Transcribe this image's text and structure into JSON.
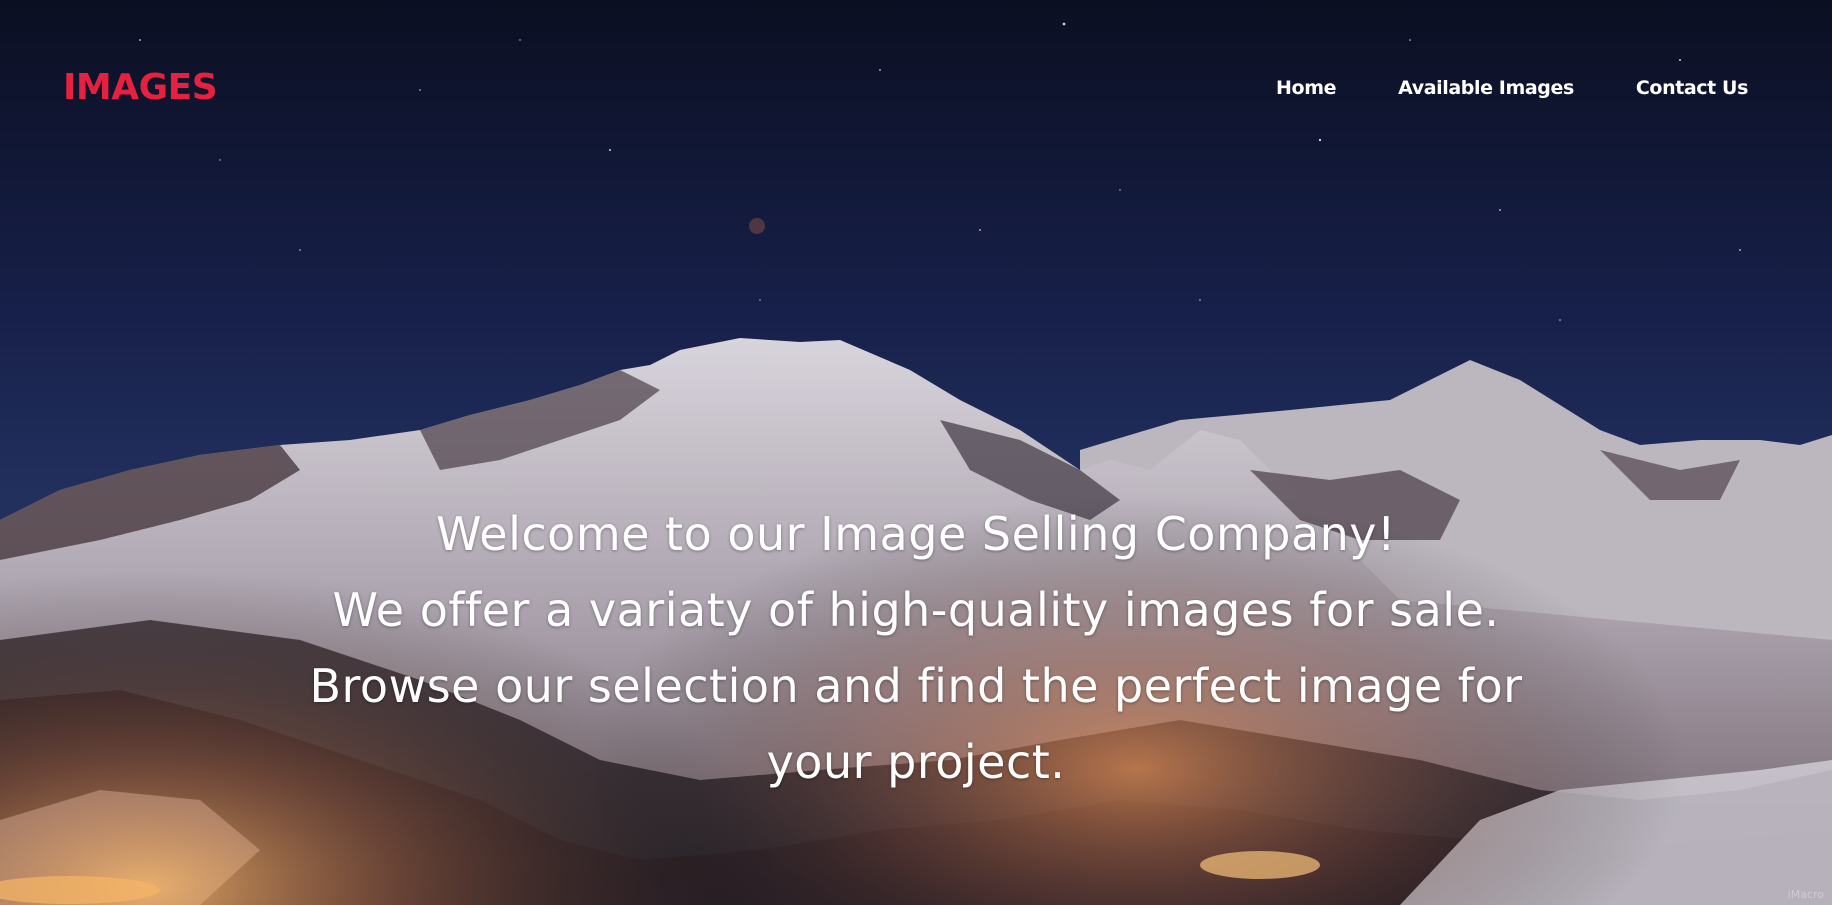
{
  "brand": {
    "logo_text": "IMAGES",
    "logo_color": "#e5213f"
  },
  "nav": {
    "items": [
      {
        "label": "Home"
      },
      {
        "label": "Available Images"
      },
      {
        "label": "Contact Us"
      }
    ]
  },
  "hero": {
    "lines": [
      "Welcome to our Image Selling Company!",
      "We offer a variaty of high-quality images for sale.",
      "Browse our selection and find the perfect image for",
      "your project."
    ],
    "background_description_icon": "night-mountain-landscape-image"
  },
  "corner_watermark": "iMacro"
}
